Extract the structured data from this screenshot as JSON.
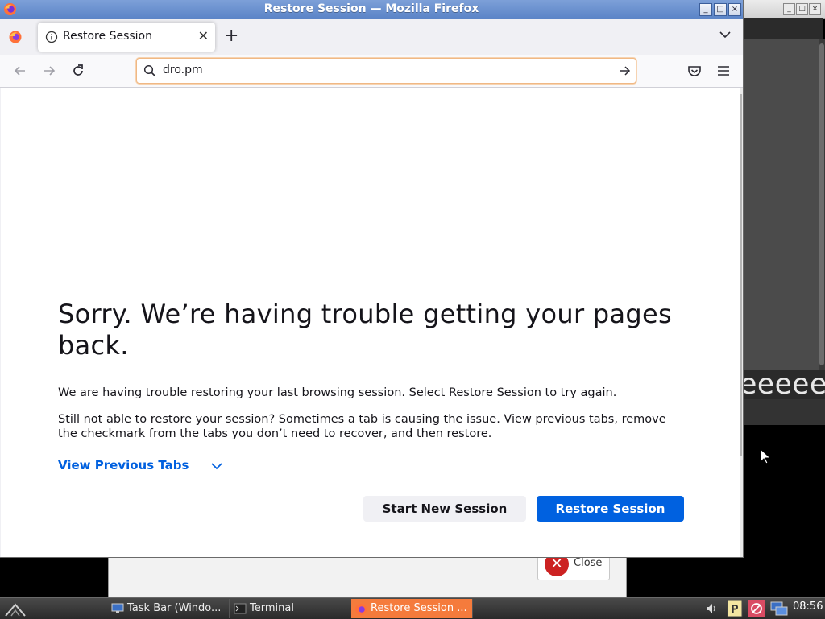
{
  "browser": {
    "window_title": "Restore Session — Mozilla Firefox",
    "tab_title": "Restore Session",
    "url": "dro.pm"
  },
  "page": {
    "title": "Sorry. We’re having trouble getting your pages back.",
    "message_1": "We are having trouble restoring your last browsing session. Select Restore Session to try again.",
    "message_2": "Still not able to restore your session? Sometimes a tab is causing the issue. View previous tabs, remove the checkmark from the tabs you don’t need to recover, and then restore.",
    "view_previous_tabs": "View Previous Tabs",
    "start_new_session": "Start New Session",
    "restore_session": "Restore Session"
  },
  "background": {
    "terminal_text": "eeeeeeeeeeeeee",
    "dialog_close_label": "Close"
  },
  "taskbar": {
    "tasks": [
      {
        "label": "Task Bar (Windo..."
      },
      {
        "label": "Terminal"
      },
      {
        "label": "Restore Session ..."
      }
    ],
    "clock": "08:56"
  },
  "colors": {
    "accent": "#0061e0",
    "link": "#0060df",
    "titlebar": "#6b8fd0",
    "active_task": "#f57b3c"
  }
}
